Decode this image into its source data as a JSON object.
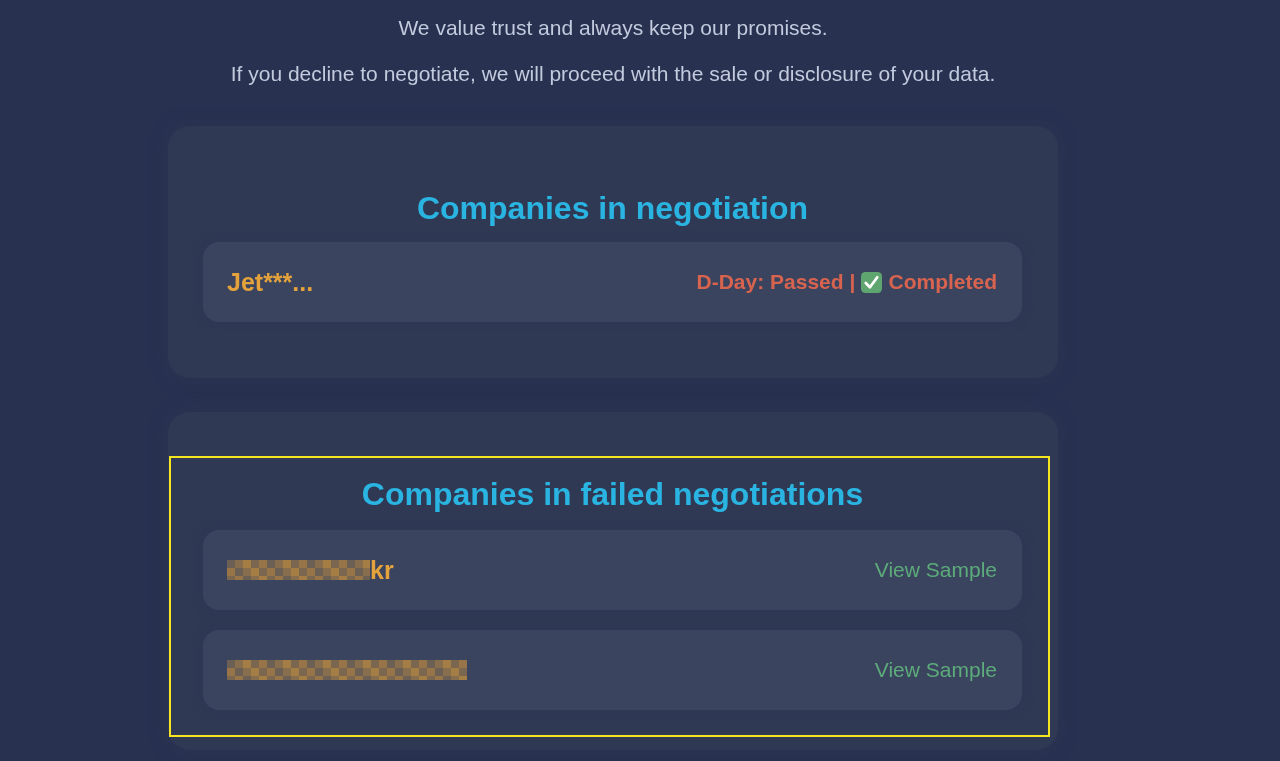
{
  "notice": {
    "lines": [
      "We value trust and always keep our promises.",
      "If you decline to negotiate, we will proceed with the sale or disclosure of your data."
    ]
  },
  "sections": [
    {
      "title": "Companies in negotiation",
      "highlighted": false,
      "companies": [
        {
          "redacted": false,
          "name": "Jet***...",
          "status": {
            "deadline": "D-Day: Passed",
            "separator": "|",
            "done": true,
            "result": "Completed"
          }
        }
      ]
    },
    {
      "title": "Companies in failed negotiations",
      "highlighted": true,
      "companies": [
        {
          "redacted": true,
          "name": "kr",
          "link": "View Sample"
        },
        {
          "redacted": true,
          "link": "View Sample"
        }
      ]
    }
  ]
}
